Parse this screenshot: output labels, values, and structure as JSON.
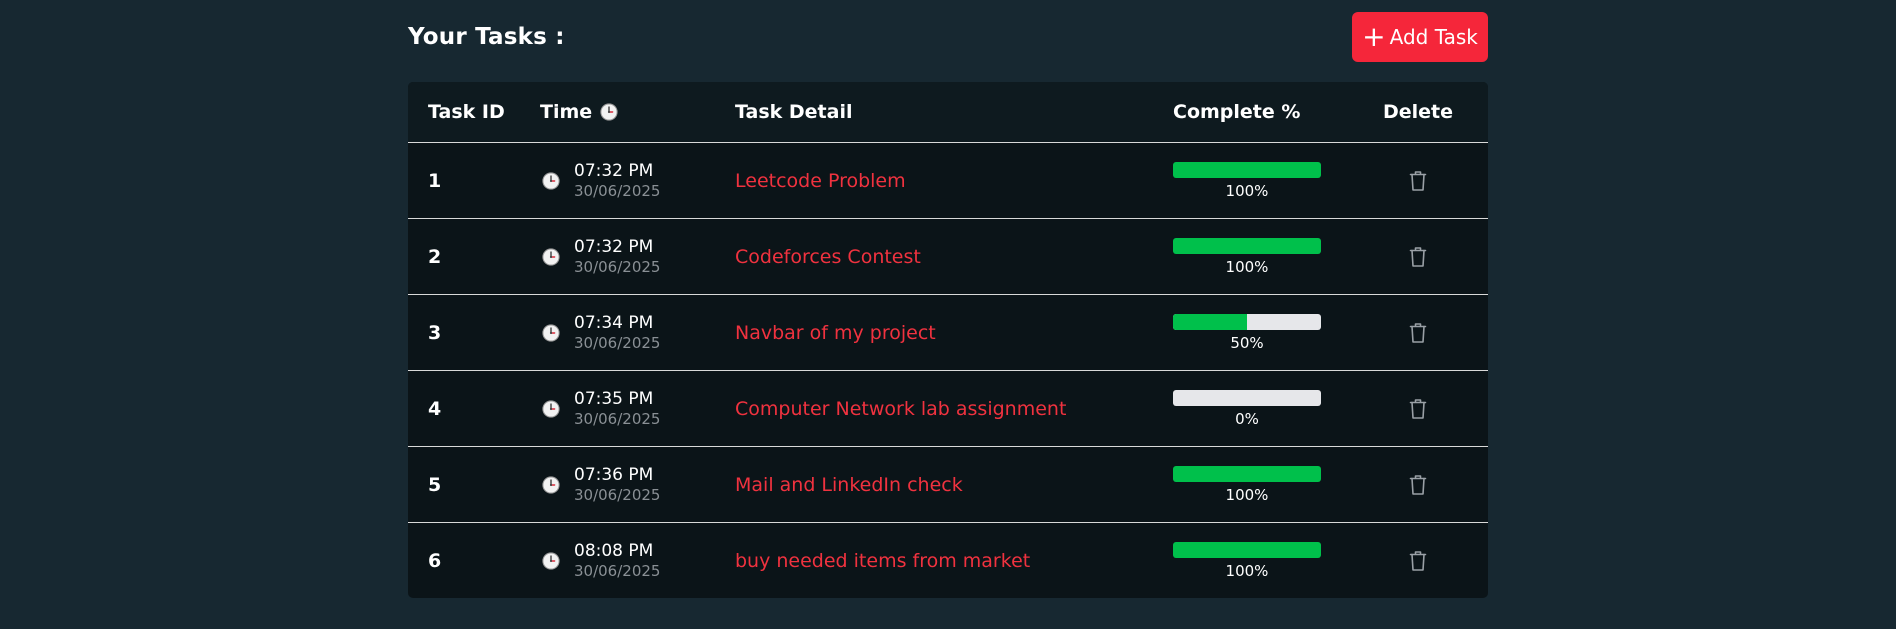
{
  "header": {
    "title": "Your Tasks :",
    "add_button_icon": "plus-icon",
    "add_button_label": "Add Task"
  },
  "table": {
    "columns": {
      "id": "Task ID",
      "time": "Time",
      "detail": "Task Detail",
      "complete": "Complete %",
      "delete": "Delete"
    },
    "rows": [
      {
        "id": "1",
        "time": "07:32 PM",
        "date": "30/06/2025",
        "detail": "Leetcode Problem",
        "complete": 1.0,
        "complete_label": "100%"
      },
      {
        "id": "2",
        "time": "07:32 PM",
        "date": "30/06/2025",
        "detail": "Codeforces Contest",
        "complete": 1.0,
        "complete_label": "100%"
      },
      {
        "id": "3",
        "time": "07:34 PM",
        "date": "30/06/2025",
        "detail": "Navbar of my project",
        "complete": 0.5,
        "complete_label": "50%"
      },
      {
        "id": "4",
        "time": "07:35 PM",
        "date": "30/06/2025",
        "detail": "Computer Network lab assignment",
        "complete": 0.0,
        "complete_label": "0%"
      },
      {
        "id": "5",
        "time": "07:36 PM",
        "date": "30/06/2025",
        "detail": "Mail and LinkedIn check",
        "complete": 1.0,
        "complete_label": "100%"
      },
      {
        "id": "6",
        "time": "08:08 PM",
        "date": "30/06/2025",
        "detail": "buy needed items from market",
        "complete": 1.0,
        "complete_label": "100%"
      }
    ]
  },
  "colors": {
    "background": "#172831",
    "accent": "#f5263a",
    "task_text": "#f0323f",
    "progress_fill": "#00c04b",
    "progress_track": "#e6e7ea"
  },
  "icons": {
    "clock": "clock-icon",
    "delete": "trash-icon"
  }
}
